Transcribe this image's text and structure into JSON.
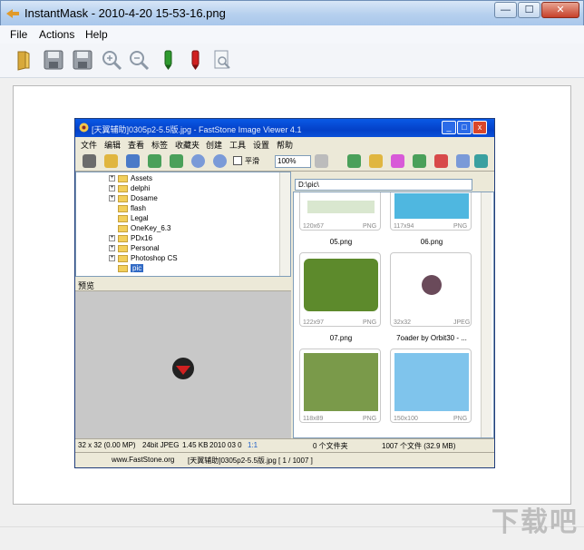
{
  "window": {
    "title": "InstantMask - 2010-4-20 15-53-16.png"
  },
  "window_controls": {
    "minimize": "—",
    "maximize": "☐",
    "close": "✕"
  },
  "menu": {
    "items": [
      "File",
      "Actions",
      "Help"
    ]
  },
  "toolbar": {
    "icons": [
      "open-folder-icon",
      "save-icon",
      "save-as-icon",
      "zoom-in-icon",
      "zoom-out-icon",
      "green-marker-icon",
      "red-marker-icon",
      "fit-page-icon"
    ]
  },
  "colors": {
    "accent": "#0a5ae6",
    "green_marker": "#2e9a2e",
    "red_marker": "#d02020",
    "folder": "#f2cf5b"
  },
  "embedded": {
    "title": "[天翼辅助]0305p2-5.5版.jpg - FastStone Image Viewer 4.1",
    "menu": [
      "文件",
      "编辑",
      "查看",
      "标签",
      "收藏夹",
      "创建",
      "工具",
      "设置",
      "帮助"
    ],
    "zoom": "100%",
    "smooth_label": "平滑",
    "tree": [
      "Assets",
      "delphi",
      "Dosame",
      "flash",
      "Legal",
      "OneKey_6.3",
      "PDx16",
      "Personal",
      "Photoshop CS",
      "pic"
    ],
    "preview_label": "预览",
    "path": "D:\\pic\\",
    "thumbs": [
      {
        "size": "120x67",
        "fmt": "PNG",
        "name": "05.png"
      },
      {
        "size": "117x94",
        "fmt": "PNG",
        "name": "06.png"
      },
      {
        "size": "122x97",
        "fmt": "PNG",
        "name": "07.png"
      },
      {
        "size": "32x32",
        "fmt": "JPEG",
        "name": "7oader by Orbit30 - ..."
      },
      {
        "size": "118x89",
        "fmt": "PNG",
        "name": ""
      },
      {
        "size": "150x100",
        "fmt": "PNG",
        "name": ""
      }
    ],
    "status": {
      "dims": "32 x 32 (0.00 MP)",
      "depth": "24bit JPEG",
      "size": "1.45 KB",
      "date": "2010 03 0",
      "ratio": "1:1",
      "folders": "0 个文件夹",
      "files": "1007 个文件 (32.9 MB)"
    },
    "footer": {
      "site": "www.FastStone.org",
      "file": "[天翼辅助]0305p2-5.5版.jpg [ 1 / 1007 ]"
    }
  },
  "watermark": "下载吧"
}
